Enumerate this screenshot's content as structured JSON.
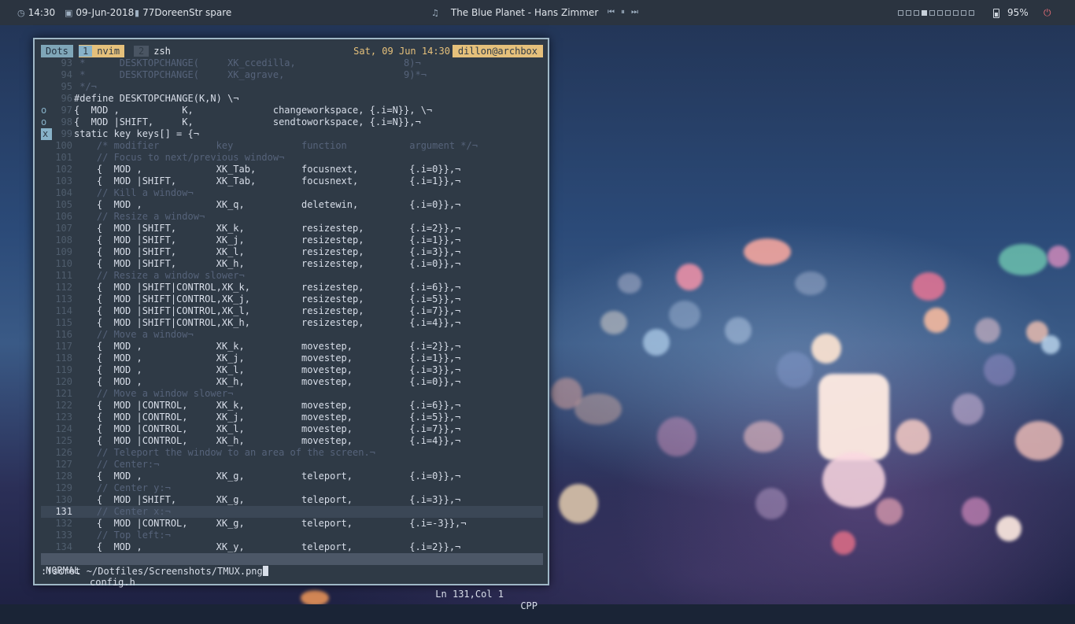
{
  "topbar": {
    "time": "14:30",
    "date": "09-Jun-2018",
    "network": "77DoreenStr spare",
    "now_playing": "The Blue Planet - Hans Zimmer",
    "workspaces_total": 10,
    "workspace_active": 4,
    "battery": "95%",
    "icons": [
      "clock-icon",
      "calendar-icon",
      "wifi-icon",
      "music-note-icon",
      "previous-icon",
      "pause-icon",
      "next-icon",
      "battery-icon",
      "power-icon"
    ]
  },
  "tmux": {
    "session": "Dots",
    "windows": [
      {
        "index": "1",
        "name": "nvim"
      },
      {
        "index": "2",
        "name": "zsh"
      }
    ],
    "datetime": "Sat, 09 Jun 14:30",
    "user_host": "dillon@archbox"
  },
  "editor": {
    "current_line": "131",
    "lines": [
      {
        "n": "93",
        "sign": "",
        "t": " *      DESKTOPCHANGE(     XK_ccedilla,                   8)¬",
        "c": "cm"
      },
      {
        "n": "94",
        "sign": "",
        "t": " *      DESKTOPCHANGE(     XK_agrave,                     9)*¬",
        "c": "cm"
      },
      {
        "n": "95",
        "sign": "",
        "t": " */¬",
        "c": "cm"
      },
      {
        "n": "96",
        "sign": "",
        "t": "#define DESKTOPCHANGE(K,N) \\¬",
        "c": ""
      },
      {
        "n": "97",
        "sign": "o",
        "t": "{  MOD ,           K,              changeworkspace, {.i=N}}, \\¬",
        "c": ""
      },
      {
        "n": "98",
        "sign": "o",
        "t": "{  MOD |SHIFT,     K,              sendtoworkspace, {.i=N}},¬",
        "c": ""
      },
      {
        "n": "99",
        "sign": "x",
        "t": "static key keys[] = {¬",
        "c": ""
      },
      {
        "n": "100",
        "sign": "",
        "t": "    /* modifier          key            function           argument */¬",
        "c": "cm"
      },
      {
        "n": "101",
        "sign": "",
        "t": "    // Focus to next/previous window¬",
        "c": "cm"
      },
      {
        "n": "102",
        "sign": "",
        "t": "    {  MOD ,             XK_Tab,        focusnext,         {.i=0}},¬",
        "c": ""
      },
      {
        "n": "103",
        "sign": "",
        "t": "    {  MOD |SHIFT,       XK_Tab,        focusnext,         {.i=1}},¬",
        "c": ""
      },
      {
        "n": "104",
        "sign": "",
        "t": "    // Kill a window¬",
        "c": "cm"
      },
      {
        "n": "105",
        "sign": "",
        "t": "    {  MOD ,             XK_q,          deletewin,         {.i=0}},¬",
        "c": ""
      },
      {
        "n": "106",
        "sign": "",
        "t": "    // Resize a window¬",
        "c": "cm"
      },
      {
        "n": "107",
        "sign": "",
        "t": "    {  MOD |SHIFT,       XK_k,          resizestep,        {.i=2}},¬",
        "c": ""
      },
      {
        "n": "108",
        "sign": "",
        "t": "    {  MOD |SHIFT,       XK_j,          resizestep,        {.i=1}},¬",
        "c": ""
      },
      {
        "n": "109",
        "sign": "",
        "t": "    {  MOD |SHIFT,       XK_l,          resizestep,        {.i=3}},¬",
        "c": ""
      },
      {
        "n": "110",
        "sign": "",
        "t": "    {  MOD |SHIFT,       XK_h,          resizestep,        {.i=0}},¬",
        "c": ""
      },
      {
        "n": "111",
        "sign": "",
        "t": "    // Resize a window slower¬",
        "c": "cm"
      },
      {
        "n": "112",
        "sign": "",
        "t": "    {  MOD |SHIFT|CONTROL,XK_k,         resizestep,        {.i=6}},¬",
        "c": ""
      },
      {
        "n": "113",
        "sign": "",
        "t": "    {  MOD |SHIFT|CONTROL,XK_j,         resizestep,        {.i=5}},¬",
        "c": ""
      },
      {
        "n": "114",
        "sign": "",
        "t": "    {  MOD |SHIFT|CONTROL,XK_l,         resizestep,        {.i=7}},¬",
        "c": ""
      },
      {
        "n": "115",
        "sign": "",
        "t": "    {  MOD |SHIFT|CONTROL,XK_h,         resizestep,        {.i=4}},¬",
        "c": ""
      },
      {
        "n": "116",
        "sign": "",
        "t": "    // Move a window¬",
        "c": "cm"
      },
      {
        "n": "117",
        "sign": "",
        "t": "    {  MOD ,             XK_k,          movestep,          {.i=2}},¬",
        "c": ""
      },
      {
        "n": "118",
        "sign": "",
        "t": "    {  MOD ,             XK_j,          movestep,          {.i=1}},¬",
        "c": ""
      },
      {
        "n": "119",
        "sign": "",
        "t": "    {  MOD ,             XK_l,          movestep,          {.i=3}},¬",
        "c": ""
      },
      {
        "n": "120",
        "sign": "",
        "t": "    {  MOD ,             XK_h,          movestep,          {.i=0}},¬",
        "c": ""
      },
      {
        "n": "121",
        "sign": "",
        "t": "    // Move a window slower¬",
        "c": "cm"
      },
      {
        "n": "122",
        "sign": "",
        "t": "    {  MOD |CONTROL,     XK_k,          movestep,          {.i=6}},¬",
        "c": ""
      },
      {
        "n": "123",
        "sign": "",
        "t": "    {  MOD |CONTROL,     XK_j,          movestep,          {.i=5}},¬",
        "c": ""
      },
      {
        "n": "124",
        "sign": "",
        "t": "    {  MOD |CONTROL,     XK_l,          movestep,          {.i=7}},¬",
        "c": ""
      },
      {
        "n": "125",
        "sign": "",
        "t": "    {  MOD |CONTROL,     XK_h,          movestep,          {.i=4}},¬",
        "c": ""
      },
      {
        "n": "126",
        "sign": "",
        "t": "    // Teleport the window to an area of the screen.¬",
        "c": "cm"
      },
      {
        "n": "127",
        "sign": "",
        "t": "    // Center:¬",
        "c": "cm"
      },
      {
        "n": "128",
        "sign": "",
        "t": "    {  MOD ,             XK_g,          teleport,          {.i=0}},¬",
        "c": ""
      },
      {
        "n": "129",
        "sign": "",
        "t": "    // Center y:¬",
        "c": "cm"
      },
      {
        "n": "130",
        "sign": "",
        "t": "    {  MOD |SHIFT,       XK_g,          teleport,          {.i=3}},¬",
        "c": ""
      },
      {
        "n": "131",
        "sign": "",
        "t": "    // Center x:¬",
        "c": "cm"
      },
      {
        "n": "132",
        "sign": "",
        "t": "    {  MOD |CONTROL,     XK_g,          teleport,          {.i=-3}},¬",
        "c": ""
      },
      {
        "n": "133",
        "sign": "",
        "t": "    // Top left:¬",
        "c": "cm"
      },
      {
        "n": "134",
        "sign": "",
        "t": "    {  MOD ,             XK_y,          teleport,          {.i=2}},¬",
        "c": ""
      }
    ]
  },
  "statusline": {
    "mode": "NORMAL",
    "filename": "config.h",
    "position": "Ln 131,Col 1",
    "filetype": "CPP"
  },
  "cmdline": {
    "text": ":!scrot ~/Dotfiles/Screenshots/TMUX.png"
  },
  "colors": {
    "accent_yellow": "#e5c07b",
    "accent_blue": "#88b2c9",
    "terminal_bg": "#2f3a46",
    "bar_bg": "#2b3440"
  }
}
